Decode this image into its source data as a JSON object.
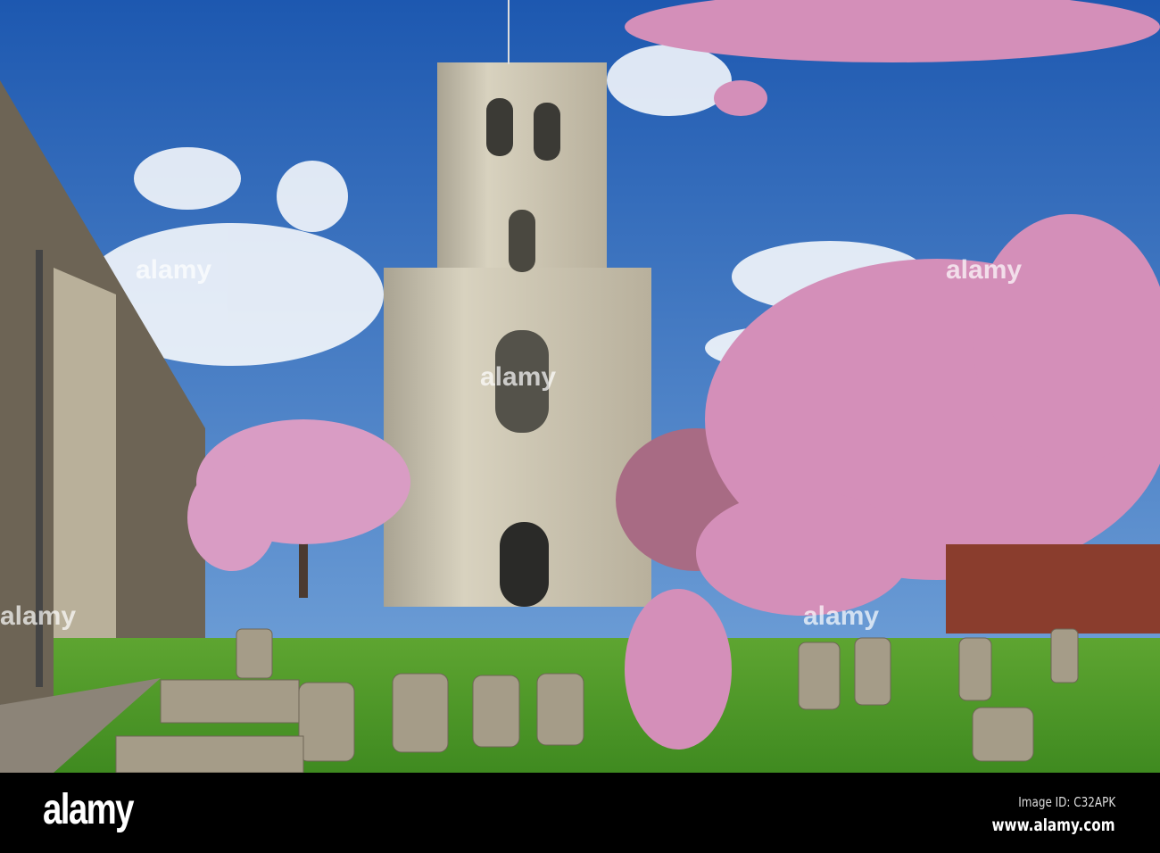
{
  "photo": {
    "watermark": "alamy",
    "colors": {
      "sky_top": "#1f5fb8",
      "sky_bottom": "#6fa2dc",
      "stone": "#c9c2ad",
      "grass": "#4f9a2a",
      "blossom": "#d98fb8"
    }
  },
  "footer": {
    "logo": "alamy",
    "image_id": "Image ID: C32APK",
    "website": "www.alamy.com"
  }
}
